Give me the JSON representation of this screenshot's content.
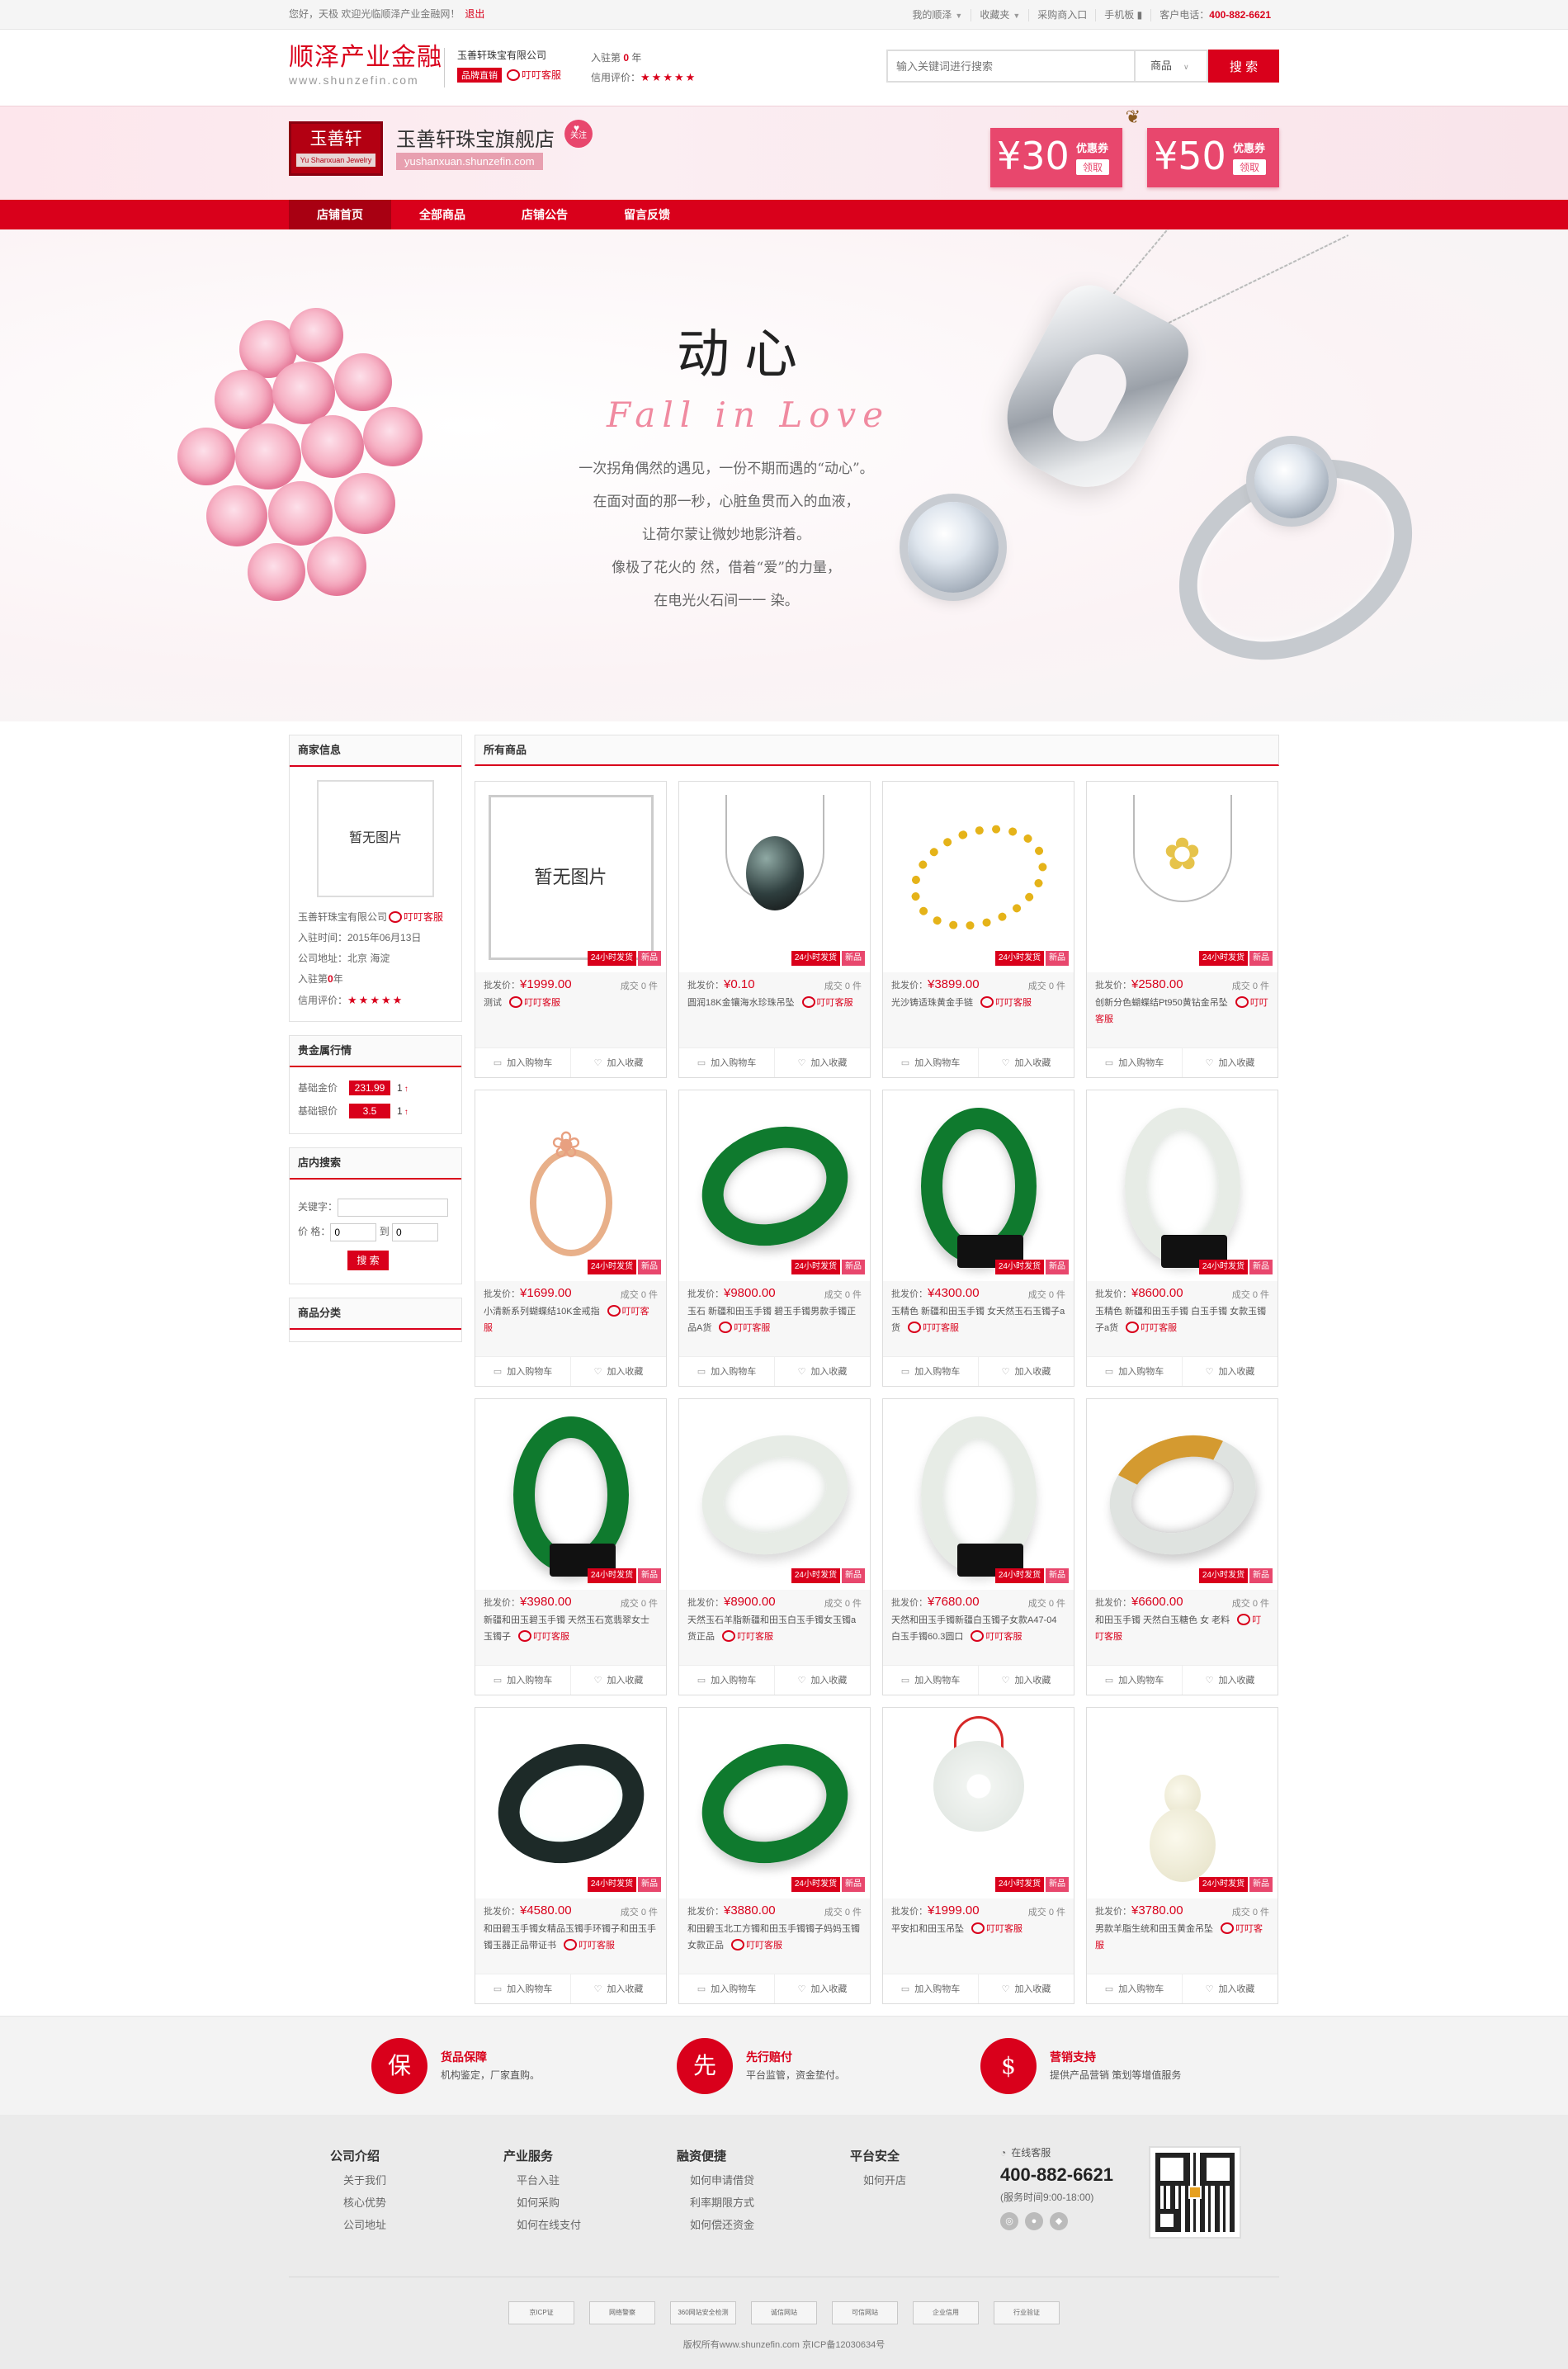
{
  "topbar": {
    "greeting": "您好，天极 欢迎光临顺泽产业金融网！",
    "logout": "退出",
    "my_account": "我的顺泽",
    "favorites": "收藏夹",
    "purchaser_entry": "采购商入口",
    "mobile": "手机板",
    "phone_label": "客户电话：",
    "phone": "400-882-6621"
  },
  "header": {
    "logo_cn": "顺泽产业金融",
    "logo_en": "www.shunzefin.com",
    "company": "玉善轩珠宝有限公司",
    "brand_badge": "品牌直销",
    "kefu": "叮叮客服",
    "join_label": "入驻第",
    "join_years": "0",
    "join_unit": "年",
    "credit_label": "信用评价：",
    "stars": "★★★★★",
    "search_placeholder": "输入关键词进行搜索",
    "search_category": "商品",
    "search_button": "搜 索"
  },
  "shop": {
    "logo_cn": "玉善轩",
    "logo_en": "Yu Shanxuan Jewelry",
    "name": "玉善轩珠宝旗舰店",
    "follow": "关注",
    "url": "yushanxuan.shunzefin.com",
    "coupons": [
      {
        "amount": "¥30",
        "label": "优惠券",
        "action": "领取"
      },
      {
        "amount": "¥50",
        "label": "优惠券",
        "action": "领取"
      }
    ]
  },
  "nav": [
    "店铺首页",
    "全部商品",
    "店铺公告",
    "留言反馈"
  ],
  "hero": {
    "title": "动心",
    "subtitle": "Fall in Love",
    "poem": [
      "一次拐角偶然的遇见，一份不期而遇的“动心”。",
      "在面对面的那一秒，心脏鱼贯而入的血液，",
      "让荷尔蒙让微妙地影浒着。",
      "像极了花火的  然，借着“爱”的力量，",
      "在电光火石间一一  染。"
    ]
  },
  "sidebar": {
    "merchant": {
      "title": "商家信息",
      "no_image": "暂无图片",
      "company": "玉善轩珠宝有限公司",
      "kefu": "叮叮客服",
      "join_date": "入驻时间：2015年06月13日",
      "address": "公司地址：北京 海淀",
      "join_label": "入驻第",
      "join_years": "0",
      "join_unit": "年",
      "credit_label": "信用评价：",
      "stars": "★★★★★"
    },
    "metals": {
      "title": "贵金属行情",
      "rows": [
        {
          "name": "基础金价",
          "value": "231.99",
          "change": "1"
        },
        {
          "name": "基础银价",
          "value": "3.5",
          "change": "1"
        }
      ]
    },
    "store_search": {
      "title": "店内搜索",
      "keyword_label": "关键字：",
      "price_label": "价  格：",
      "price_min": "0",
      "to": "到",
      "price_max": "0",
      "button": "搜 索"
    },
    "categories": {
      "title": "商品分类"
    }
  },
  "products": {
    "title": "所有商品",
    "tag_24h": "24小时发货",
    "tag_new": "新品",
    "price_label": "批发价：",
    "sold_label": "成交",
    "sold_unit": "件",
    "add_cart": "加入购物车",
    "add_fav": "加入收藏",
    "kefu": "叮叮客服",
    "no_image": "暂无图片",
    "items": [
      {
        "price": "¥1999.00",
        "sold": "0",
        "name": "测试",
        "visual": "noimg"
      },
      {
        "price": "¥0.10",
        "sold": "0",
        "name": "圆润18K金镶海水珍珠吊坠",
        "visual": "pearl"
      },
      {
        "price": "¥3899.00",
        "sold": "0",
        "name": "光沙铸适珠黄金手链",
        "visual": "bracelet"
      },
      {
        "price": "¥2580.00",
        "sold": "0",
        "name": "创新分色蝴蝶结Pt950黄钻金吊坠",
        "visual": "bow"
      },
      {
        "price": "¥1699.00",
        "sold": "0",
        "name": "小清新系列蝴蝶结10K金戒指",
        "visual": "rosering"
      },
      {
        "price": "¥9800.00",
        "sold": "0",
        "name": "玉石 新疆和田玉手镯 碧玉手镯男款手镯正品A货",
        "visual": "green"
      },
      {
        "price": "¥4300.00",
        "sold": "0",
        "name": "玉精色 新疆和田玉手镯 女天然玉石玉镯子a货",
        "visual": "green-up"
      },
      {
        "price": "¥8600.00",
        "sold": "0",
        "name": "玉精色 新疆和田玉手镯 白玉手镯 女款玉镯子a货",
        "visual": "white-up"
      },
      {
        "price": "¥3980.00",
        "sold": "0",
        "name": "新疆和田玉碧玉手镯 天然玉石宽翡翠女士玉镯子",
        "visual": "green-up"
      },
      {
        "price": "¥8900.00",
        "sold": "0",
        "name": "天然玉石羊脂新疆和田玉白玉手镯女玉镯a货正品",
        "visual": "white"
      },
      {
        "price": "¥7680.00",
        "sold": "0",
        "name": "天然和田玉手镯新疆白玉镯子女款A47-04 白玉手镯60.3圆口",
        "visual": "white-up"
      },
      {
        "price": "¥6600.00",
        "sold": "0",
        "name": "和田玉手镯 天然白玉糖色 女 老料",
        "visual": "mottled"
      },
      {
        "price": "¥4580.00",
        "sold": "0",
        "name": "和田碧玉手镯女精品玉镯手环镯子和田玉手镯玉器正品带证书",
        "visual": "dark"
      },
      {
        "price": "¥3880.00",
        "sold": "0",
        "name": "和田碧玉北工方镯和田玉手镯镯子妈妈玉镯女款正品",
        "visual": "green"
      },
      {
        "price": "¥1999.00",
        "sold": "0",
        "name": "平安扣和田玉吊坠",
        "visual": "disc"
      },
      {
        "price": "¥3780.00",
        "sold": "0",
        "name": "男款羊脂生统和田玉黄金吊坠",
        "visual": "gourd"
      }
    ]
  },
  "services": [
    {
      "icon": "保",
      "title": "货品保障",
      "desc": "机构鉴定，厂家直购。"
    },
    {
      "icon": "先",
      "title": "先行赔付",
      "desc": "平台监管，资金垫付。"
    },
    {
      "icon": "$",
      "title": "营销支持",
      "desc": "提供产品营销 策划等增值服务"
    }
  ],
  "footer": {
    "columns": [
      {
        "title": "公司介绍",
        "links": [
          "关于我们",
          "核心优势",
          "公司地址"
        ]
      },
      {
        "title": "产业服务",
        "links": [
          "平台入驻",
          "如何采购",
          "如何在线支付"
        ]
      },
      {
        "title": "融资便捷",
        "links": [
          "如何申请借贷",
          "利率期限方式",
          "如何偿还资金"
        ]
      },
      {
        "title": "平台安全",
        "links": [
          "如何开店"
        ]
      }
    ],
    "online": "在线客服",
    "tel": "400-882-6621",
    "hours": "(服务时间9:00-18:00)",
    "badges": [
      "京ICP证",
      "网络警察",
      "360网站安全检测",
      "诚信网站",
      "可信网站",
      "企业信用",
      "行业验证"
    ],
    "copyright": "版权所有www.shunzefin.com 京ICP备12030634号"
  },
  "colors": {
    "brand_red": "#d9001b",
    "nav_active": "#a80012",
    "coupon_pink": "#e8476d"
  }
}
